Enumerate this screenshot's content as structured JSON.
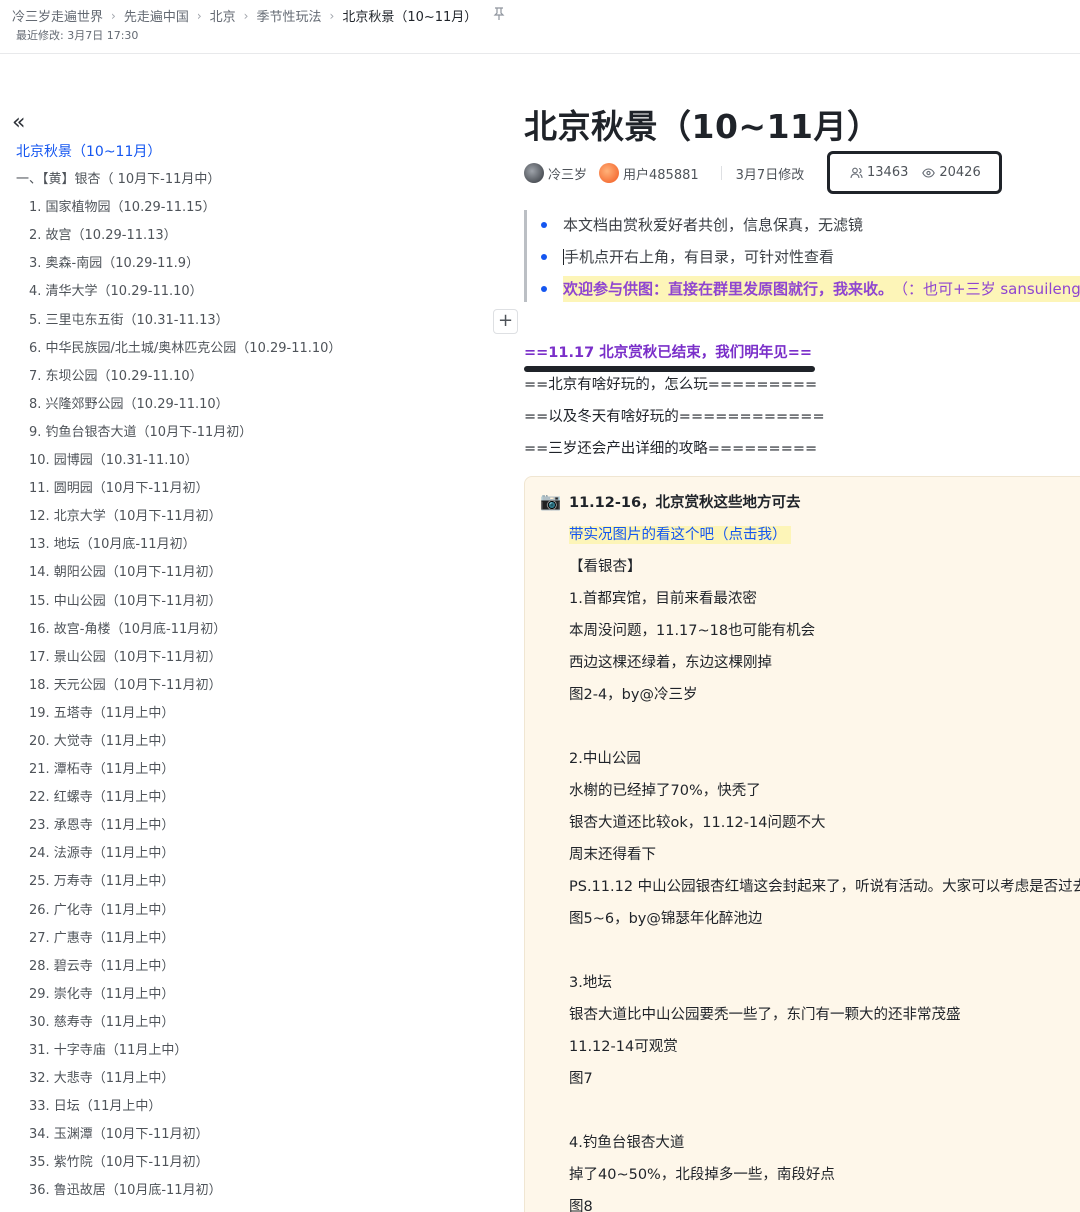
{
  "breadcrumb": [
    "冷三岁走遍世界",
    "先走遍中国",
    "北京",
    "季节性玩法",
    "北京秋景（10~11月）"
  ],
  "last_modified": "最近修改: 3月7日 17:30",
  "toc": {
    "toggle_icon": "«",
    "items": [
      {
        "label": "北京秋景（10~11月）",
        "level": "h1"
      },
      {
        "label": "一、【黄】银杏（ 10月下-11月中）",
        "level": "h2"
      },
      {
        "label": "1. 国家植物园（10.29-11.15）",
        "level": "h3"
      },
      {
        "label": "2. 故宫（10.29-11.13）",
        "level": "h3"
      },
      {
        "label": "3. 奥森-南园（10.29-11.9）",
        "level": "h3"
      },
      {
        "label": "4. 清华大学（10.29-11.10）",
        "level": "h3"
      },
      {
        "label": "5. 三里屯东五街（10.31-11.13）",
        "level": "h3"
      },
      {
        "label": "6. 中华民族园/北土城/奥林匹克公园（10.29-11.10）",
        "level": "h3"
      },
      {
        "label": "7. 东坝公园（10.29-11.10）",
        "level": "h3"
      },
      {
        "label": "8. 兴隆郊野公园（10.29-11.10）",
        "level": "h3"
      },
      {
        "label": "9. 钓鱼台银杏大道（10月下-11月初）",
        "level": "h3"
      },
      {
        "label": "10. 园博园（10.31-11.10）",
        "level": "h3"
      },
      {
        "label": "11. 圆明园（10月下-11月初）",
        "level": "h3"
      },
      {
        "label": "12. 北京大学（10月下-11月初）",
        "level": "h3"
      },
      {
        "label": "13. 地坛（10月底-11月初）",
        "level": "h3"
      },
      {
        "label": "14. 朝阳公园（10月下-11月初）",
        "level": "h3"
      },
      {
        "label": "15. 中山公园（10月下-11月初）",
        "level": "h3"
      },
      {
        "label": "16. 故宫-角楼（10月底-11月初）",
        "level": "h3"
      },
      {
        "label": "17. 景山公园（10月下-11月初）",
        "level": "h3"
      },
      {
        "label": "18. 天元公园（10月下-11月初）",
        "level": "h3"
      },
      {
        "label": "19. 五塔寺（11月上中）",
        "level": "h3"
      },
      {
        "label": "20. 大觉寺（11月上中）",
        "level": "h3"
      },
      {
        "label": "21. 潭柘寺（11月上中）",
        "level": "h3"
      },
      {
        "label": "22. 红螺寺（11月上中）",
        "level": "h3"
      },
      {
        "label": "23. 承恩寺（11月上中）",
        "level": "h3"
      },
      {
        "label": "24. 法源寺（11月上中）",
        "level": "h3"
      },
      {
        "label": "25. 万寿寺（11月上中）",
        "level": "h3"
      },
      {
        "label": "26. 广化寺（11月上中）",
        "level": "h3"
      },
      {
        "label": "27. 广惠寺（11月上中）",
        "level": "h3"
      },
      {
        "label": "28. 碧云寺（11月上中）",
        "level": "h3"
      },
      {
        "label": "29. 崇化寺（11月上中）",
        "level": "h3"
      },
      {
        "label": "30. 慈寿寺（11月上中）",
        "level": "h3"
      },
      {
        "label": "31. 十字寺庙（11月上中）",
        "level": "h3"
      },
      {
        "label": "32. 大悲寺（11月上中）",
        "level": "h3"
      },
      {
        "label": "33. 日坛（11月上中）",
        "level": "h3"
      },
      {
        "label": "34. 玉渊潭（10月下-11月初）",
        "level": "h3"
      },
      {
        "label": "35. 紫竹院（10月下-11月初）",
        "level": "h3"
      },
      {
        "label": "36. 鲁迅故居（10月底-11月初）",
        "level": "h3"
      }
    ]
  },
  "doc": {
    "title": "北京秋景（10~11月）",
    "author1": "冷三岁",
    "author2": "用户485881",
    "modified": "3月7日修改",
    "collaborators": "13463",
    "views": "20426",
    "quote": {
      "line1": "本文档由赏秋爱好者共创，信息保真，无滤镜",
      "line2": "手机点开右上角，有目录，可针对性查看",
      "line3_bold": "欢迎参与供图：直接在群里发原图就行，我来收。",
      "line3_rest": "（：也可+三岁 sansuileng"
    },
    "announcement": "==11.17 北京赏秋已结束，我们明年见==",
    "line_a": "==北京有啥好玩的，怎么玩=========",
    "line_b": "==以及冬天有啥好玩的============",
    "line_c": "==三岁还会产出详细的攻略========="
  },
  "callout": {
    "icon": "📷",
    "heading": "11.12-16，北京赏秋这些地方可去",
    "link": "带实况图片的看这个吧（点击我）",
    "lines": [
      "【看银杏】",
      "1.首都宾馆，目前来看最浓密",
      "本周没问题，11.17~18也可能有机会",
      "西边这棵还绿着，东边这棵刚掉",
      "图2-4，by@冷三岁",
      "",
      "2.中山公园",
      "水榭的已经掉了70%，快秃了",
      "银杏大道还比较ok，11.12-14问题不大",
      "周末还得看下",
      "PS.11.12 中山公园银杏红墙这会封起来了，听说有活动。大家可以考虑是否过去",
      "图5~6，by@锦瑟年化醉池边",
      "",
      "3.地坛",
      "银杏大道比中山公园要秃一些了，东门有一颗大的还非常茂盛",
      "11.12-14可观赏",
      "图7",
      "",
      "4.钓鱼台银杏大道",
      "掉了40~50%，北段掉多一些，南段好点",
      "图8"
    ]
  }
}
